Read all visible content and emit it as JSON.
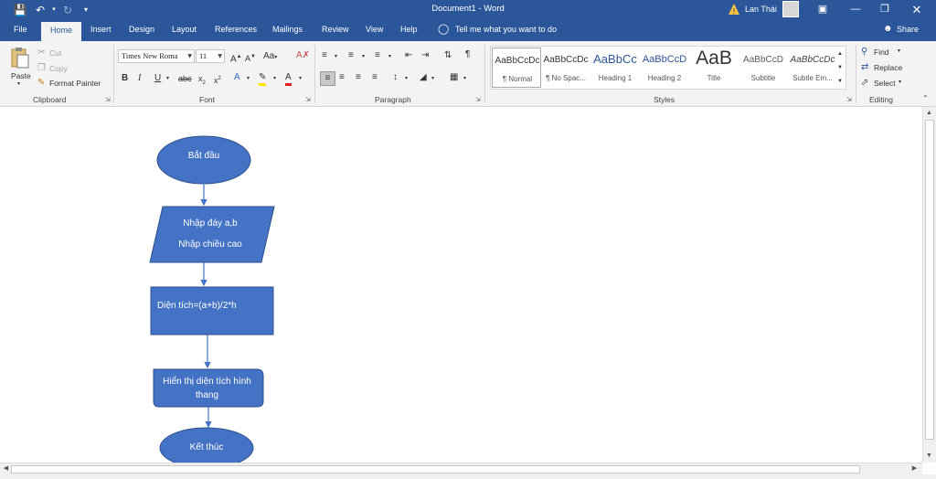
{
  "app": {
    "title": "Document1 - Word",
    "user": "Lan Thái",
    "share_label": "Share",
    "tell_me": "Tell me what you want to do"
  },
  "tabs": [
    "File",
    "Home",
    "Insert",
    "Design",
    "Layout",
    "References",
    "Mailings",
    "Review",
    "View",
    "Help"
  ],
  "ribbon": {
    "clipboard": {
      "label": "Clipboard",
      "paste": "Paste",
      "cut": "Cut",
      "copy": "Copy",
      "format_painter": "Format Painter"
    },
    "font": {
      "label": "Font",
      "family": "Times New Roma",
      "size": "11"
    },
    "paragraph": {
      "label": "Paragraph"
    },
    "styles": {
      "label": "Styles",
      "items": [
        {
          "sample": "AaBbCcDc",
          "name": "¶ Normal"
        },
        {
          "sample": "AaBbCcDc",
          "name": "¶ No Spac..."
        },
        {
          "sample": "AaBbCc",
          "name": "Heading 1"
        },
        {
          "sample": "AaBbCcD",
          "name": "Heading 2"
        },
        {
          "sample": "AaB",
          "name": "Title"
        },
        {
          "sample": "AaBbCcD",
          "name": "Subtitle"
        },
        {
          "sample": "AaBbCcDc",
          "name": "Subtle Em..."
        }
      ]
    },
    "editing": {
      "label": "Editing",
      "find": "Find",
      "replace": "Replace",
      "select": "Select"
    }
  },
  "flowchart": {
    "start": "Bắt đầu",
    "input_line1": "Nhập đáy a,b",
    "input_line2": "Nhập chiều  cao",
    "process": "Diện tích=(a+b)/2*h",
    "output_line1": "Hiển thị diện tích hình",
    "output_line2": "thang",
    "end": "Kết thúc"
  },
  "colors": {
    "title_bar": "#2b579a",
    "ribbon": "#f3f3f3",
    "shape_fill": "#4472c4",
    "shape_stroke": "#2f528f"
  }
}
